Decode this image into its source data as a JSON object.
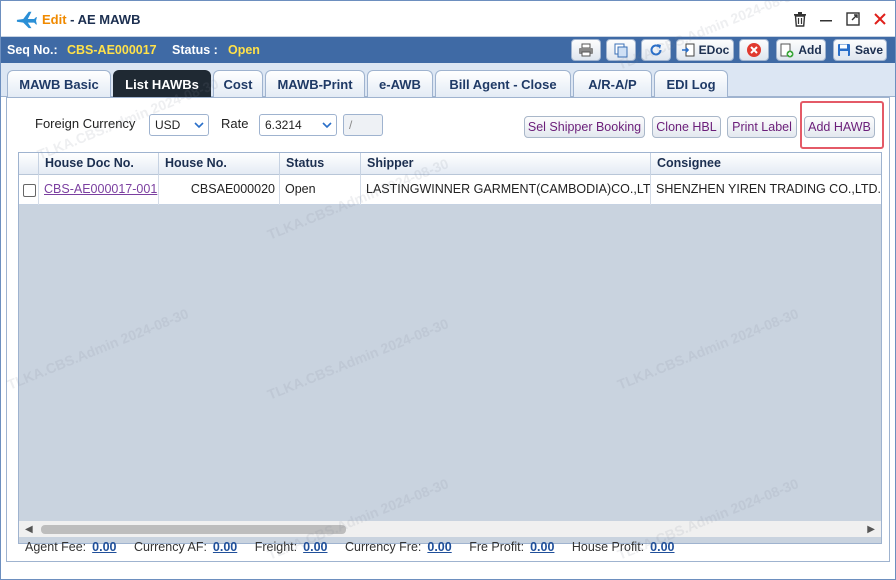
{
  "window": {
    "edit_label": "Edit",
    "separator": " - ",
    "title": "AE MAWB"
  },
  "seq": {
    "seq_label": "Seq No.:",
    "seq_value": "CBS-AE000017",
    "status_label": "Status :",
    "status_value": "Open"
  },
  "toolbar": {
    "edoc_label": "EDoc",
    "add_label": "Add",
    "save_label": "Save"
  },
  "tabs": [
    {
      "label": "MAWB Basic"
    },
    {
      "label": "List HAWBs"
    },
    {
      "label": "Cost"
    },
    {
      "label": "MAWB-Print"
    },
    {
      "label": "e-AWB"
    },
    {
      "label": "Bill Agent - Close"
    },
    {
      "label": "A/R-A/P"
    },
    {
      "label": "EDI Log"
    }
  ],
  "active_tab": "List HAWBs",
  "filters": {
    "currency_label": "Foreign Currency",
    "currency_value": "USD",
    "rate_label": "Rate",
    "rate_value": "6.3214",
    "extra_value": "/"
  },
  "actions": {
    "sel_shipper_booking": "Sel Shipper Booking",
    "clone_hbl": "Clone HBL",
    "print_label": "Print Label",
    "add_hawb": "Add HAWB"
  },
  "grid": {
    "columns": [
      "House Doc No.",
      "House No.",
      "Status",
      "Shipper",
      "Consignee"
    ],
    "rows": [
      {
        "house_doc_no": "CBS-AE000017-001",
        "house_no": "CBSAE000020",
        "status": "Open",
        "shipper": "LASTINGWINNER GARMENT(CAMBODIA)CO.,LTD",
        "consignee": "SHENZHEN YIREN TRADING CO.,LTD.C"
      }
    ]
  },
  "totals": {
    "agent_fee_label": "Agent Fee:",
    "agent_fee": "0.00",
    "currency_af_label": "Currency AF:",
    "currency_af": "0.00",
    "freight_label": "Freight:",
    "freight": "0.00",
    "currency_fre_label": "Currency Fre:",
    "currency_fre": "0.00",
    "fre_profit_label": "Fre Profit:",
    "fre_profit": "0.00",
    "house_profit_label": "House Profit:",
    "house_profit": "0.00"
  },
  "watermark": "TLKA.CBS.Admin 2024-08-30",
  "icons": {
    "app": "airplane-icon",
    "delete": "trash-icon",
    "minimize": "minimize-icon",
    "maximize": "maximize-icon",
    "close": "close-icon",
    "print": "printer-icon",
    "copy": "copy-icon",
    "refresh": "refresh-icon",
    "edoc": "edoc-icon",
    "cancel": "cancel-icon",
    "add": "add-document-icon",
    "save": "floppy-icon"
  },
  "colors": {
    "accent": "#3f6aa5",
    "edit_orange": "#f08a00",
    "seq_value": "#ffe14a",
    "link_purple": "#7b3fa0",
    "highlight": "#e45a67"
  }
}
